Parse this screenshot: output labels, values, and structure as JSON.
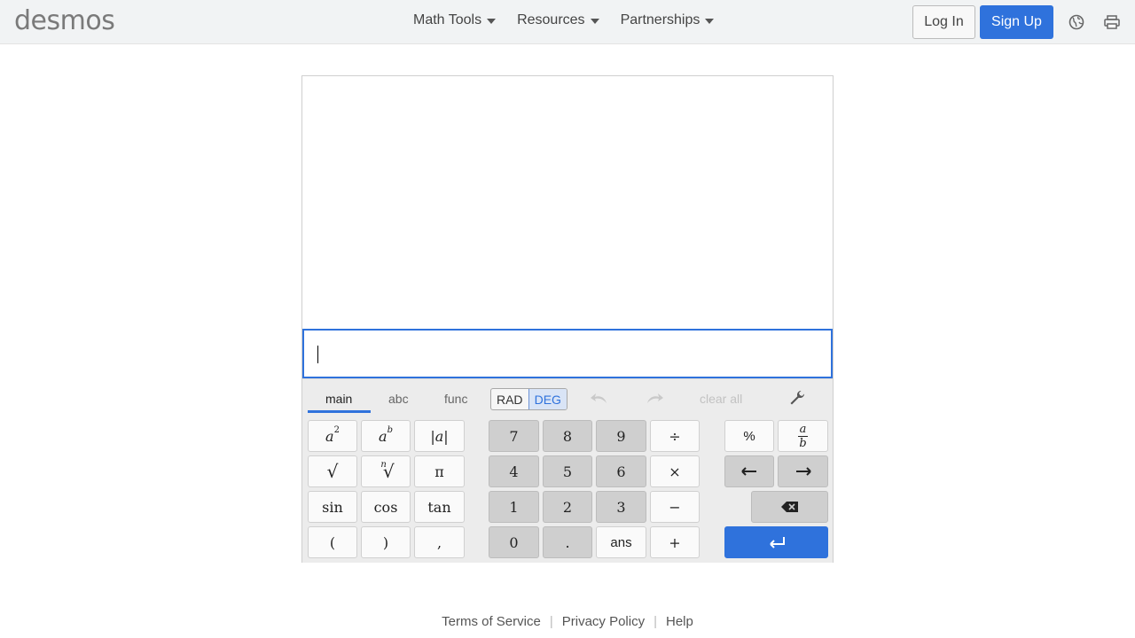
{
  "header": {
    "logo": "desmos",
    "nav": [
      "Math Tools",
      "Resources",
      "Partnerships"
    ],
    "login": "Log In",
    "signup": "Sign Up"
  },
  "calculator": {
    "tabs": [
      "main",
      "abc",
      "func"
    ],
    "active_tab": "main",
    "angle_modes": [
      "RAD",
      "DEG"
    ],
    "selected_angle_mode": "DEG",
    "clear_all": "clear all",
    "keys": {
      "sqrt": "√",
      "pi": "π",
      "sin": "sin",
      "cos": "cos",
      "tan": "tan",
      "lparen": "(",
      "rparen": ")",
      "comma": ",",
      "n7": "7",
      "n8": "8",
      "n9": "9",
      "n4": "4",
      "n5": "5",
      "n6": "6",
      "n1": "1",
      "n2": "2",
      "n3": "3",
      "n0": "0",
      "dot": ".",
      "ans": "ans",
      "divide": "÷",
      "times": "×",
      "minus": "−",
      "plus": "+",
      "percent": "%"
    }
  },
  "footer": {
    "links": [
      "Terms of Service",
      "Privacy Policy",
      "Help"
    ]
  },
  "colors": {
    "accent": "#2f72dc",
    "header_bg": "#f1f3f4",
    "keypad_bg": "#ececec"
  }
}
